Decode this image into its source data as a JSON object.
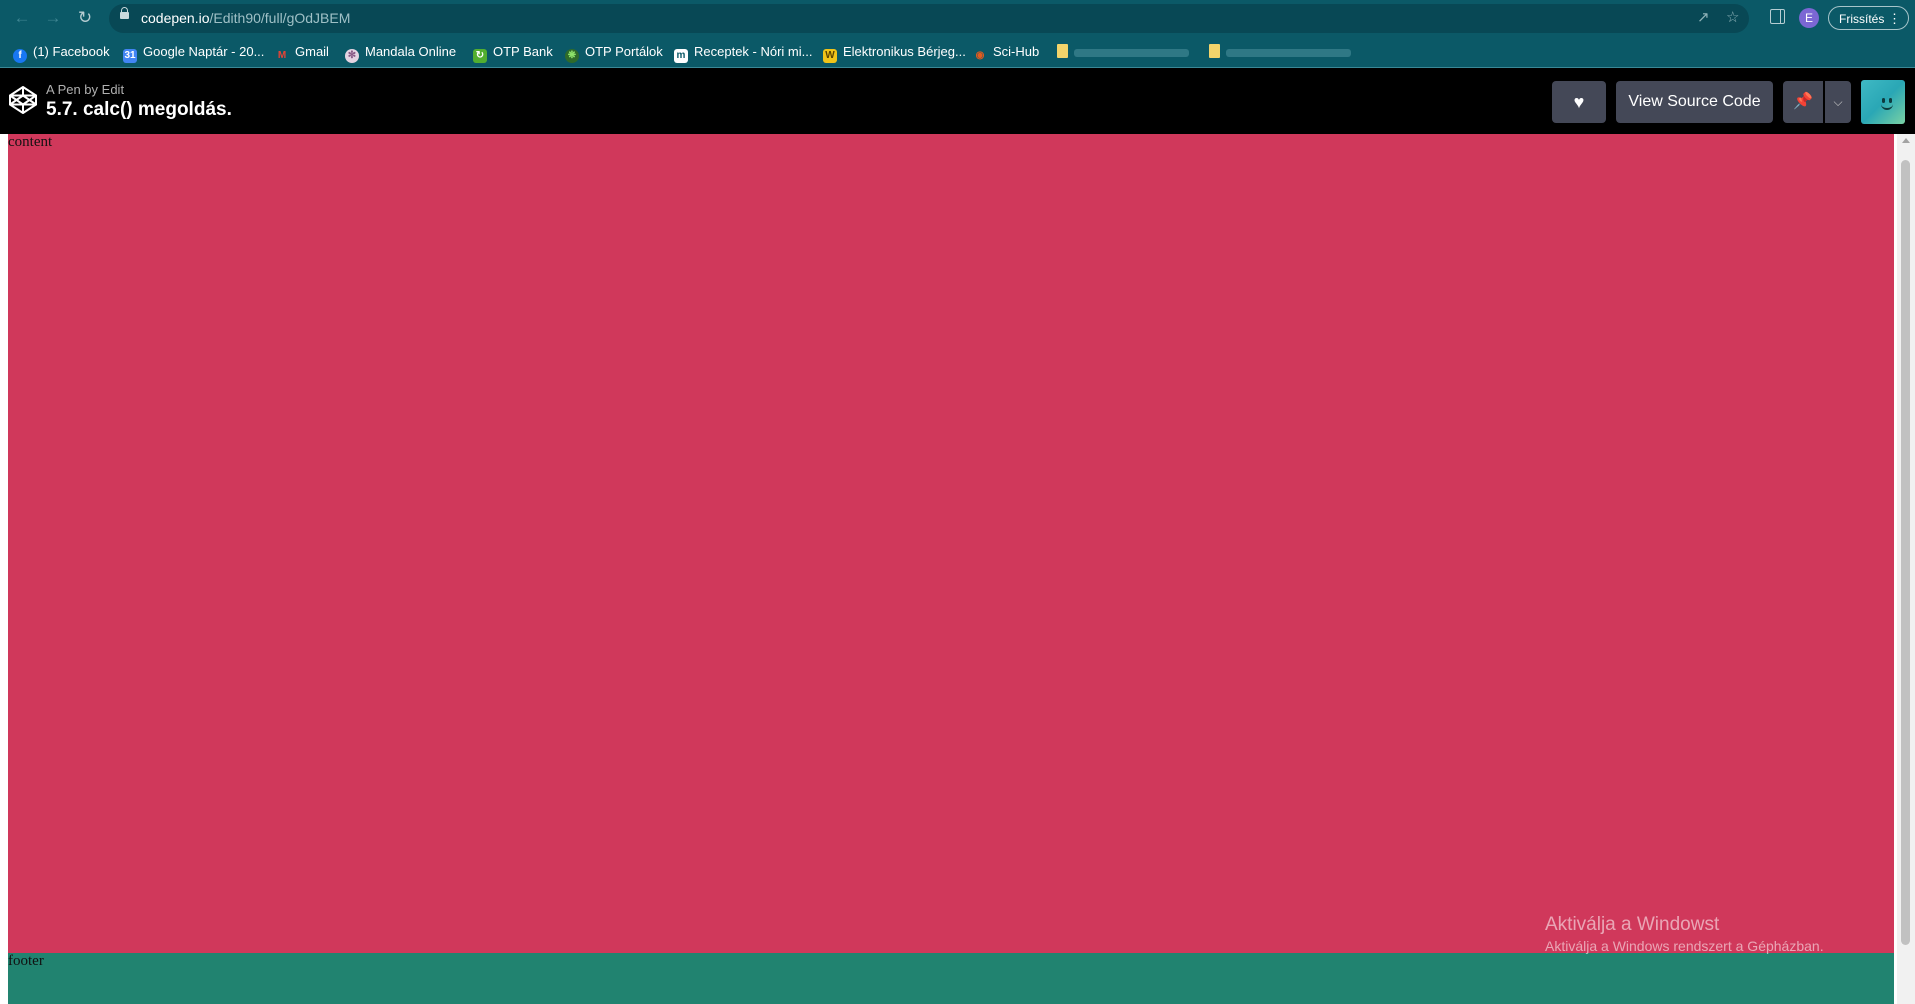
{
  "browser": {
    "url_host": "codepen.io",
    "url_path": "/Edith90/full/gOdJBEM",
    "profile_initial": "E",
    "update_label": "Frissítés"
  },
  "bookmarks": [
    {
      "label": "(1) Facebook",
      "icon": "facebook-icon",
      "color": "#1877f2"
    },
    {
      "label": "Google Naptár - 20...",
      "icon": "google-calendar-icon",
      "color": "#4285f4"
    },
    {
      "label": "Gmail",
      "icon": "gmail-icon",
      "color": "#ea4335"
    },
    {
      "label": "Mandala Online",
      "icon": "mandala-icon",
      "color": "#c9a0c4"
    },
    {
      "label": "OTP Bank",
      "icon": "otp-bank-icon",
      "color": "#52ae30"
    },
    {
      "label": "OTP Portálok",
      "icon": "otp-portal-icon",
      "color": "#52ae30"
    },
    {
      "label": "Receptek - Nóri mi...",
      "icon": "receptek-icon",
      "color": "#ffffff"
    },
    {
      "label": "Elektronikus Bérjeg...",
      "icon": "payslip-icon",
      "color": "#f0c419"
    },
    {
      "label": "Sci-Hub",
      "icon": "sci-hub-icon",
      "color": "#e35b1e"
    }
  ],
  "codepen": {
    "pen_by": "A Pen by Edit",
    "title": "5.7. calc() megoldás.",
    "view_source_label": "View Source Code"
  },
  "page": {
    "content_label": "content",
    "footer_label": "footer",
    "content_color": "#d0385b",
    "footer_color": "#218370"
  },
  "watermark": {
    "line1": "Aktiválja a Windowst",
    "line2": "Aktiválja a Windows rendszert a Gépházban."
  }
}
